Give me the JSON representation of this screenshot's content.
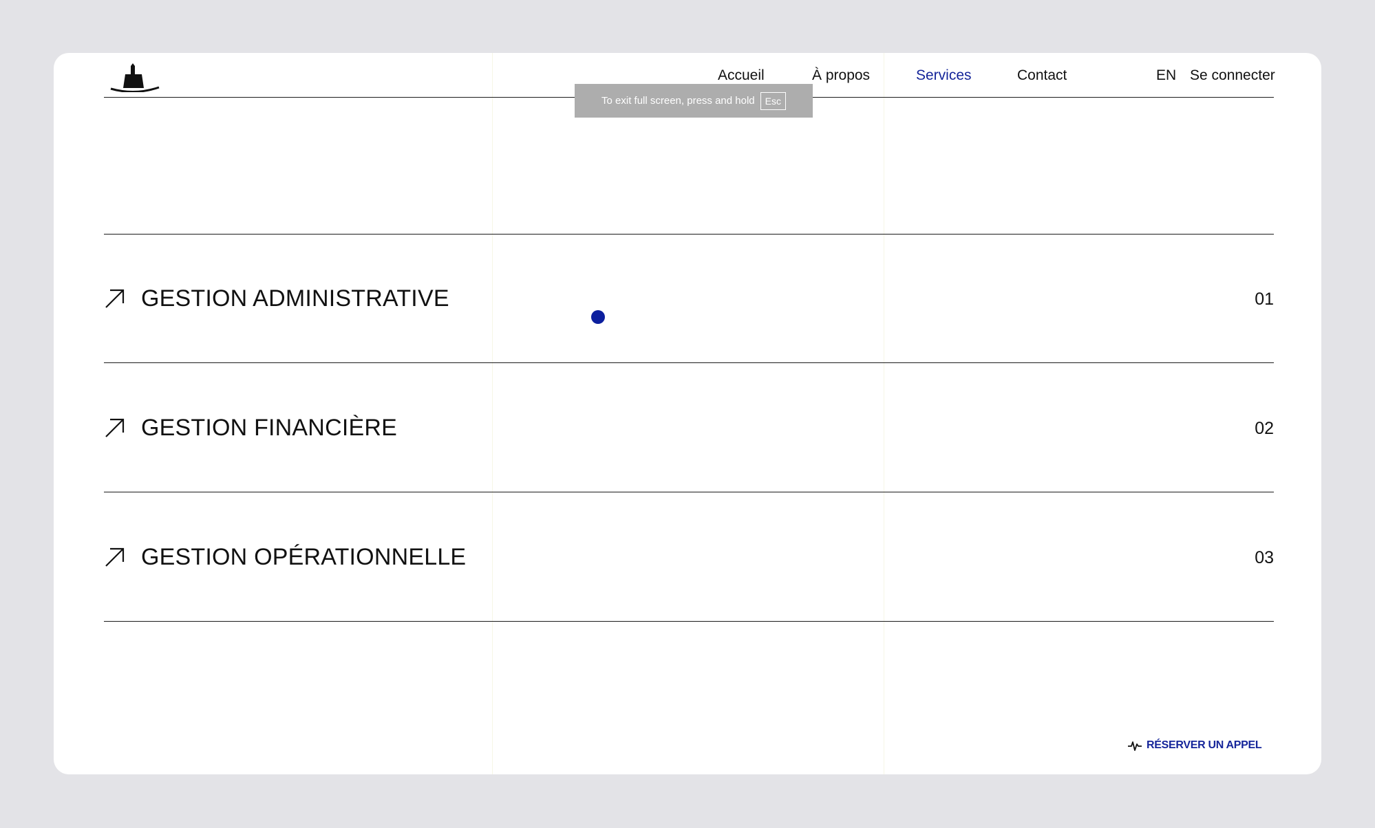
{
  "nav": {
    "items": [
      {
        "label": "Accueil",
        "active": false
      },
      {
        "label": "À propos",
        "active": false
      },
      {
        "label": "Services",
        "active": true
      },
      {
        "label": "Contact",
        "active": false
      }
    ],
    "language": "EN",
    "login": "Se connecter"
  },
  "fullscreen_notice": {
    "text": "To exit full screen, press and hold",
    "key": "Esc"
  },
  "services": [
    {
      "title": "GESTION ADMINISTRATIVE",
      "number": "01",
      "icon": "arrow-up-right-icon"
    },
    {
      "title": "GESTION FINANCIÈRE",
      "number": "02",
      "icon": "arrow-up-right-icon"
    },
    {
      "title": "GESTION OPÉRATIONNELLE",
      "number": "03",
      "icon": "arrow-up-right-icon"
    }
  ],
  "cta": {
    "label": "RÉSERVER UN APPEL",
    "icon": "pulse-icon"
  },
  "colors": {
    "accent": "#15259a",
    "background": "#e3e3e7",
    "card": "#ffffff",
    "text": "#111111"
  }
}
